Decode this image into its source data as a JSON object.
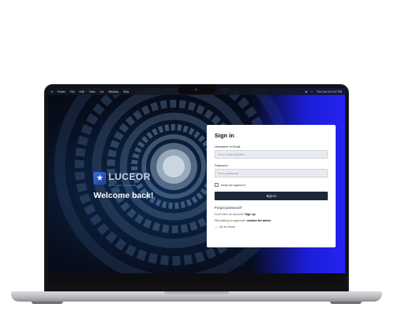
{
  "menubar": {
    "items": [
      "Finder",
      "File",
      "Edit",
      "View",
      "Go",
      "Window",
      "Help"
    ],
    "status": "Thu Oct 14 4:37 PM"
  },
  "brand": {
    "name": "LUCEOR",
    "tagline": "BUSINESS SYSTEMS"
  },
  "welcome": "Welcome back!",
  "signin": {
    "title": "Sign in",
    "username_label": "Username or Email",
    "username_placeholder": "Your email address",
    "password_label": "Password",
    "password_placeholder": "Your password",
    "remember_label": "Keep me signed in",
    "submit_label": "Sign in",
    "forgot_label": "Forgot password?",
    "no_account_text": "Don't have an account?",
    "signup_label": "Sign up",
    "waiting_text": "Still waiting for approval?",
    "contact_label": "contact the admin",
    "home_label": "Go to Home"
  },
  "colors": {
    "card_button": "#1d2738",
    "screen_accent": "#2623f0"
  }
}
